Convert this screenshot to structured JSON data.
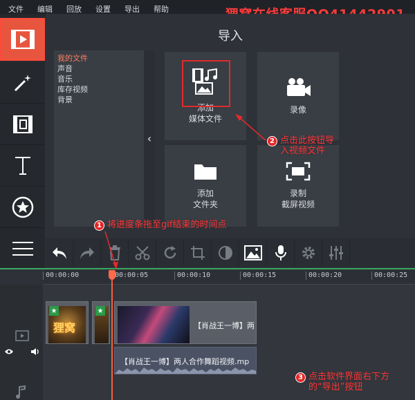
{
  "menu": [
    "文件",
    "编辑",
    "回放",
    "设置",
    "导出",
    "帮助"
  ],
  "watermark": "狸窝在线客服QQ41442901",
  "import_panel": {
    "title": "导入",
    "files": [
      "我的文件",
      "声音",
      "音乐",
      "库存视频",
      "背景"
    ],
    "selected_file": "我的文件",
    "tiles": {
      "add_media": [
        "添加",
        "媒体文件"
      ],
      "record": [
        "录像"
      ],
      "add_folder": [
        "添加",
        "文件夹"
      ],
      "record_screen": [
        "录制",
        "截屏视频"
      ]
    }
  },
  "tools": [
    "import-icon",
    "magic-wand-icon",
    "film-icon",
    "text-icon",
    "sticker-star-icon",
    "menu-list-icon"
  ],
  "toolbar_buttons": [
    "undo-icon",
    "redo-icon",
    "trash-icon",
    "scissors-icon",
    "rotate-icon",
    "crop-icon",
    "color-adjust-icon",
    "image-icon",
    "microphone-icon",
    "gear-icon",
    "equalizer-icon"
  ],
  "timeline": {
    "ticks": [
      "00:00:00",
      "00:00:05",
      "00:00:10",
      "00:00:15",
      "00:00:20",
      "00:00:25"
    ],
    "clip_video_title": "【肖战王一博】两",
    "clip_audio_title": "【肖战王一博】两人合作舞蹈视频.mp",
    "thumb_text": "狸窝"
  },
  "annotations": {
    "a1": {
      "num": "1",
      "text": "将进度条拖至gif结束的时间点"
    },
    "a2": {
      "num": "2",
      "line1": "点击此按钮导",
      "line2": "入视频文件"
    },
    "a3": {
      "num": "3",
      "line1": "点击软件界面右下方",
      "line2": "的“导出”按钮"
    }
  },
  "colors": {
    "accent": "#e8553e",
    "annotation": "#ff3333",
    "timeline_green": "#3aa860"
  }
}
